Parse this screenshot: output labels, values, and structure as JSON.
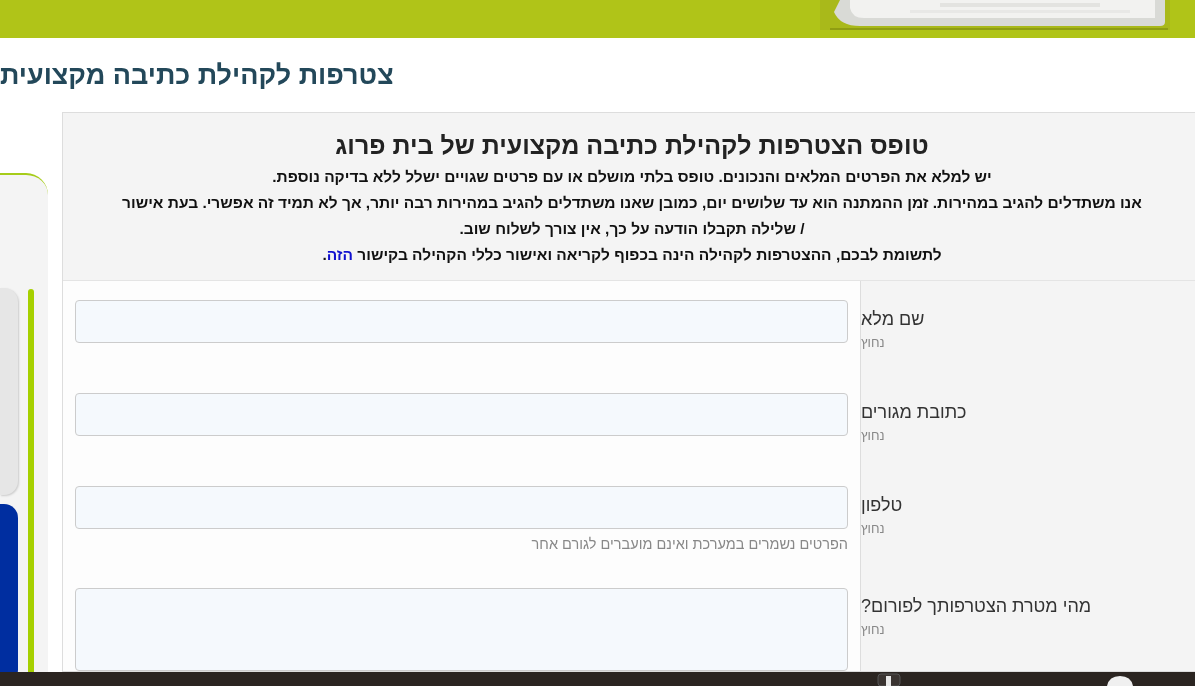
{
  "page_title": "צטרפות לקהילת כתיבה מקצועית",
  "form": {
    "title": "טופס הצטרפות לקהילת כתיבה מקצועית של בית פרוג",
    "intro": [
      "יש למלא את הפרטים המלאים והנכונים. טופס בלתי מושלם או עם פרטים שגויים ישלל ללא בדיקה נוספת.",
      "אנו משתדלים להגיב במהירות. זמן ההמתנה הוא עד שלושים יום, כמובן שאנו משתדלים להגיב במהירות רבה יותר, אך לא תמיד זה אפשרי. בעת אישור",
      "/ שלילה תקבלו הודעה על כך, אין צורך לשלוח שוב."
    ],
    "notice": {
      "text": "לתשומת לבכם, ההצטרפות לקהילה הינה בכפוף לקריאה ואישור כללי הקהילה בקישור ",
      "link": "הזה",
      "end": "."
    },
    "fields": [
      {
        "label": "שם מלא",
        "required": "נחוץ",
        "kind": "input"
      },
      {
        "label": "כתובת מגורים",
        "required": "נחוץ",
        "kind": "input"
      },
      {
        "label": "טלפון",
        "required": "נחוץ",
        "kind": "input",
        "help": "הפרטים נשמרים במערכת ואינם מועברים לגורם אחר"
      },
      {
        "label": "מהי מטרת הצטרפותך לפורום?",
        "required": "נחוץ",
        "kind": "textarea"
      }
    ]
  }
}
